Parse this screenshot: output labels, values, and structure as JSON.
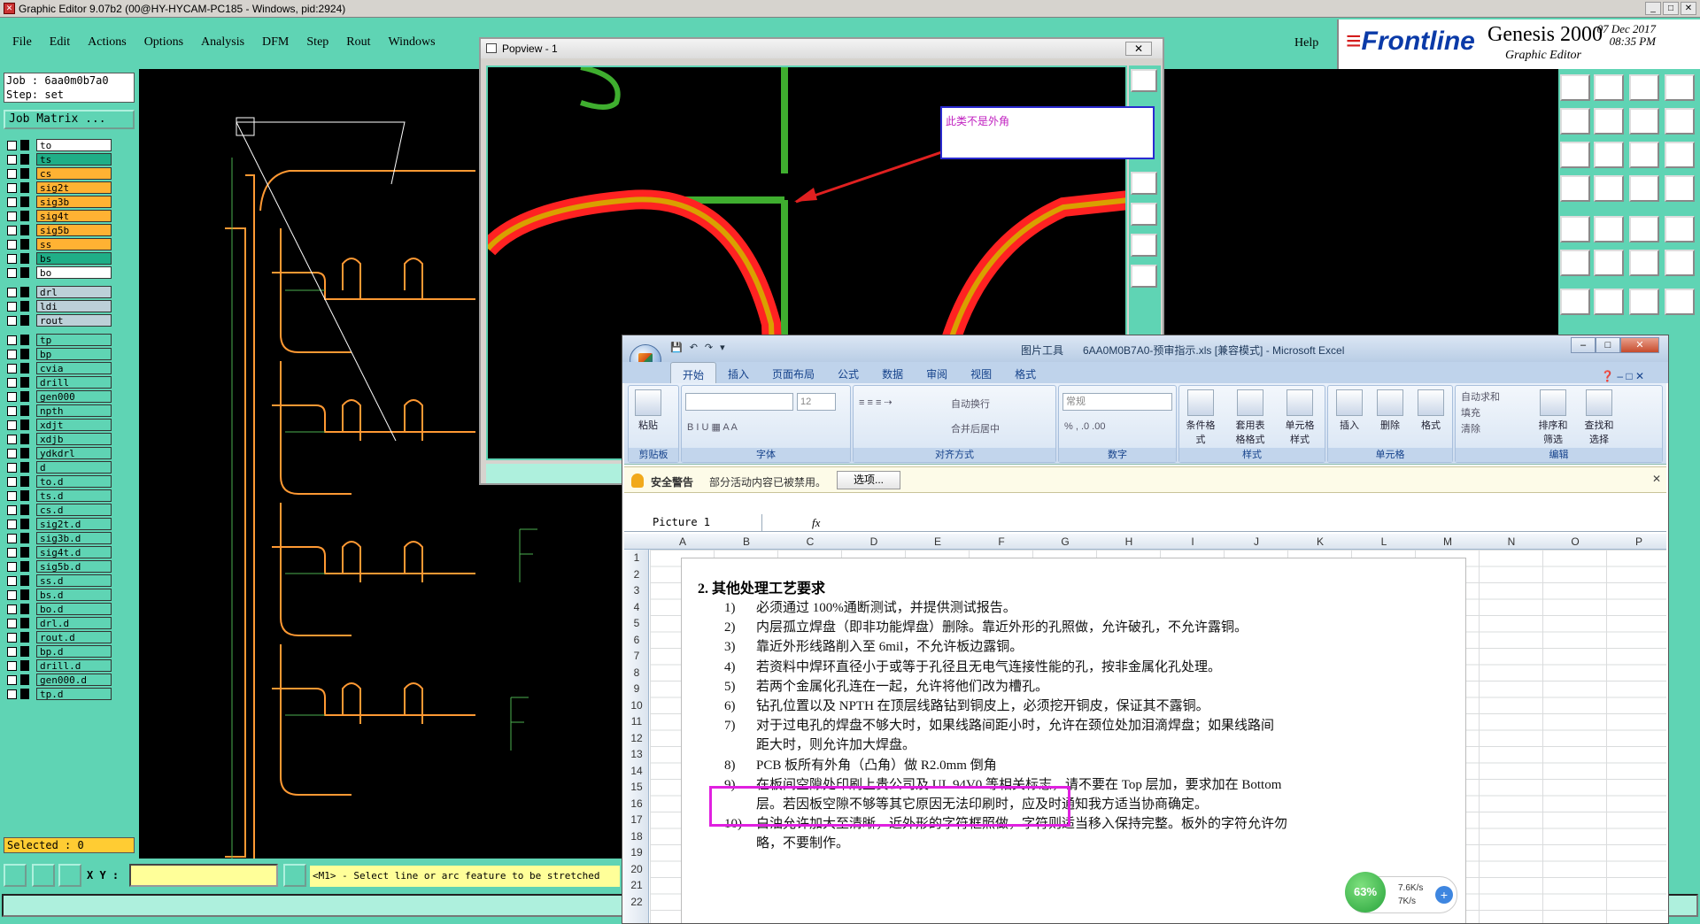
{
  "genesis": {
    "title": "Graphic Editor 9.07b2 (00@HY-HYCAM-PC185 - Windows, pid:2924)",
    "menu": [
      "File",
      "Edit",
      "Actions",
      "Options",
      "Analysis",
      "DFM",
      "Step",
      "Rout",
      "Windows"
    ],
    "help": "Help",
    "brand": "Frontline",
    "product": "Genesis 2000",
    "subtitle": "Graphic Editor",
    "date": "07 Dec 2017",
    "time": "08:35 PM",
    "job_line": "Job : 6aa0m0b7a0",
    "step_line": "Step: set",
    "job_matrix": "Job Matrix ...",
    "layers": [
      {
        "name": "to",
        "color": "#ffffff"
      },
      {
        "name": "ts",
        "color": "#1fae87"
      },
      {
        "name": "cs",
        "color": "#ffb233"
      },
      {
        "name": "sig2t",
        "color": "#ffb233"
      },
      {
        "name": "sig3b",
        "color": "#ffb233"
      },
      {
        "name": "sig4t",
        "color": "#ffb233"
      },
      {
        "name": "sig5b",
        "color": "#ffb233"
      },
      {
        "name": "ss",
        "color": "#ffb233"
      },
      {
        "name": "bs",
        "color": "#1fae87"
      },
      {
        "name": "bo",
        "color": "#ffffff"
      }
    ],
    "layers2": [
      {
        "name": "drl",
        "color": "#bcd0d8"
      },
      {
        "name": "ldi",
        "color": "#bcd0d8"
      },
      {
        "name": "rout",
        "color": "#bcd0d8"
      }
    ],
    "layers3": [
      "tp",
      "bp",
      "cvia",
      "drill",
      "gen000",
      "npth",
      "xdjt",
      "xdjb",
      "ydkdrl",
      "d",
      "to.d",
      "ts.d",
      "cs.d",
      "sig2t.d",
      "sig3b.d",
      "sig4t.d",
      "sig5b.d",
      "ss.d",
      "bs.d",
      "bo.d",
      "drl.d",
      "rout.d",
      "bp.d",
      "drill.d",
      "gen000.d",
      "tp.d"
    ],
    "selected": "Selected : 0",
    "xy_label": "X Y :",
    "prompt": "<M1> - Select line or arc feature to be stretched"
  },
  "popview": {
    "title": "Popview - 1",
    "close": "✕",
    "callout": "此类不是外角"
  },
  "excel": {
    "title_tag": "图片工具",
    "title": "6AA0M0B7A0-预审指示.xls  [兼容模式]  -  Microsoft Excel",
    "tabs": [
      "开始",
      "插入",
      "页面布局",
      "公式",
      "数据",
      "审阅",
      "视图",
      "格式"
    ],
    "groups": {
      "clipboard": "剪贴板",
      "font": "字体",
      "align": "对齐方式",
      "number": "数字",
      "style": "样式",
      "cells": "单元格",
      "edit": "编辑"
    },
    "paste": "粘贴",
    "font_size": "12",
    "wrap": "自动换行",
    "merge": "合并后居中",
    "numfmt": "常规",
    "cond_fmt": "条件格式",
    "table_fmt": "套用表格格式",
    "cell_style": "单元格样式",
    "insert": "插入",
    "delete": "删除",
    "format": "格式",
    "autosum": "自动求和",
    "fill": "填充",
    "clear": "清除",
    "sort": "排序和筛选",
    "find": "查找和选择",
    "security_label": "安全警告",
    "security_text": "部分活动内容已被禁用。",
    "security_btn": "选项...",
    "name_box": "Picture 1",
    "fx": "fx",
    "columns": [
      "A",
      "B",
      "C",
      "D",
      "E",
      "F",
      "G",
      "H",
      "I",
      "J",
      "K",
      "L",
      "M",
      "N",
      "O",
      "P"
    ],
    "rows": [
      "1",
      "2",
      "3",
      "4",
      "5",
      "6",
      "7",
      "8",
      "9",
      "10",
      "11",
      "12",
      "13",
      "14",
      "15",
      "16",
      "17",
      "18",
      "19",
      "20",
      "21",
      "22"
    ],
    "doc": {
      "heading": "2.   其他处理工艺要求",
      "items": [
        {
          "n": "1)",
          "t": "必须通过 100%通断测试，并提供测试报告。"
        },
        {
          "n": "2)",
          "t": "内层孤立焊盘（即非功能焊盘）删除。靠近外形的孔照做，允许破孔，不允许露铜。"
        },
        {
          "n": "3)",
          "t": "靠近外形线路削入至 6mil，不允许板边露铜。"
        },
        {
          "n": "4)",
          "t": "若资料中焊环直径小于或等于孔径且无电气连接性能的孔，按非金属化孔处理。"
        },
        {
          "n": "5)",
          "t": "若两个金属化孔连在一起，允许将他们改为槽孔。"
        },
        {
          "n": "6)",
          "t": "钻孔位置以及 NPTH 在顶层线路钻到铜皮上，必须挖开铜皮，保证其不露铜。"
        },
        {
          "n": "7)",
          "t": "对于过电孔的焊盘不够大时，如果线路间距小时，允许在颈位处加泪滴焊盘；如果线路间"
        },
        {
          "n": "",
          "t": "距大时，则允许加大焊盘。"
        },
        {
          "n": "8)",
          "t": "PCB 板所有外角（凸角）做 R2.0mm 倒角"
        },
        {
          "n": "9)",
          "t": "在板间空隙处印刷上贵公司及 UL 94V0 等相关标志，请不要在 Top 层加，要求加在 Bottom"
        },
        {
          "n": "",
          "t": "层。若因板空隙不够等其它原因无法印刷时，应及时通知我方适当协商确定。"
        },
        {
          "n": "10)",
          "t": "白油允许加大至清晰，近外形的字符框照做，字符则适当移入保持完整。板外的字符允许勿"
        },
        {
          "n": "",
          "t": "略，不要制作。"
        }
      ]
    }
  },
  "netmon": {
    "pct": "63%",
    "up": "7.6K/s",
    "down": "7K/s"
  }
}
